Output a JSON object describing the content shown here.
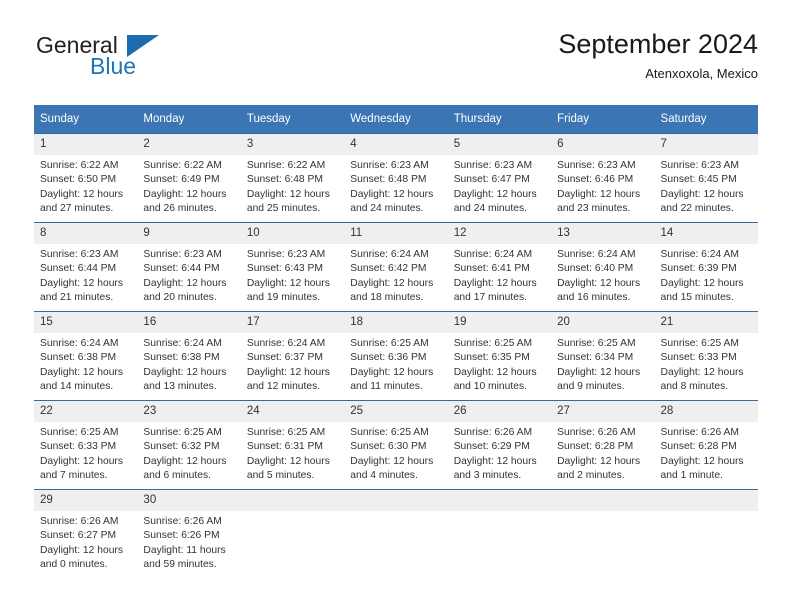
{
  "logo": {
    "text_primary": "General",
    "text_secondary": "Blue",
    "triangle_color": "#1b6cb0",
    "primary_color": "#231f20",
    "secondary_color": "#1b75bb"
  },
  "header": {
    "title": "September 2024",
    "subtitle": "Atenxoxola, Mexico"
  },
  "theme": {
    "header_row_bg": "#3b75b4",
    "header_row_text": "#ffffff",
    "daynum_bg": "#efefef",
    "cell_border": "#2e6da4"
  },
  "calendar": {
    "weekday_headers": [
      "Sunday",
      "Monday",
      "Tuesday",
      "Wednesday",
      "Thursday",
      "Friday",
      "Saturday"
    ],
    "weeks": [
      [
        {
          "day": "1",
          "sunrise": "Sunrise: 6:22 AM",
          "sunset": "Sunset: 6:50 PM",
          "daylight_line1": "Daylight: 12 hours",
          "daylight_line2": "and 27 minutes."
        },
        {
          "day": "2",
          "sunrise": "Sunrise: 6:22 AM",
          "sunset": "Sunset: 6:49 PM",
          "daylight_line1": "Daylight: 12 hours",
          "daylight_line2": "and 26 minutes."
        },
        {
          "day": "3",
          "sunrise": "Sunrise: 6:22 AM",
          "sunset": "Sunset: 6:48 PM",
          "daylight_line1": "Daylight: 12 hours",
          "daylight_line2": "and 25 minutes."
        },
        {
          "day": "4",
          "sunrise": "Sunrise: 6:23 AM",
          "sunset": "Sunset: 6:48 PM",
          "daylight_line1": "Daylight: 12 hours",
          "daylight_line2": "and 24 minutes."
        },
        {
          "day": "5",
          "sunrise": "Sunrise: 6:23 AM",
          "sunset": "Sunset: 6:47 PM",
          "daylight_line1": "Daylight: 12 hours",
          "daylight_line2": "and 24 minutes."
        },
        {
          "day": "6",
          "sunrise": "Sunrise: 6:23 AM",
          "sunset": "Sunset: 6:46 PM",
          "daylight_line1": "Daylight: 12 hours",
          "daylight_line2": "and 23 minutes."
        },
        {
          "day": "7",
          "sunrise": "Sunrise: 6:23 AM",
          "sunset": "Sunset: 6:45 PM",
          "daylight_line1": "Daylight: 12 hours",
          "daylight_line2": "and 22 minutes."
        }
      ],
      [
        {
          "day": "8",
          "sunrise": "Sunrise: 6:23 AM",
          "sunset": "Sunset: 6:44 PM",
          "daylight_line1": "Daylight: 12 hours",
          "daylight_line2": "and 21 minutes."
        },
        {
          "day": "9",
          "sunrise": "Sunrise: 6:23 AM",
          "sunset": "Sunset: 6:44 PM",
          "daylight_line1": "Daylight: 12 hours",
          "daylight_line2": "and 20 minutes."
        },
        {
          "day": "10",
          "sunrise": "Sunrise: 6:23 AM",
          "sunset": "Sunset: 6:43 PM",
          "daylight_line1": "Daylight: 12 hours",
          "daylight_line2": "and 19 minutes."
        },
        {
          "day": "11",
          "sunrise": "Sunrise: 6:24 AM",
          "sunset": "Sunset: 6:42 PM",
          "daylight_line1": "Daylight: 12 hours",
          "daylight_line2": "and 18 minutes."
        },
        {
          "day": "12",
          "sunrise": "Sunrise: 6:24 AM",
          "sunset": "Sunset: 6:41 PM",
          "daylight_line1": "Daylight: 12 hours",
          "daylight_line2": "and 17 minutes."
        },
        {
          "day": "13",
          "sunrise": "Sunrise: 6:24 AM",
          "sunset": "Sunset: 6:40 PM",
          "daylight_line1": "Daylight: 12 hours",
          "daylight_line2": "and 16 minutes."
        },
        {
          "day": "14",
          "sunrise": "Sunrise: 6:24 AM",
          "sunset": "Sunset: 6:39 PM",
          "daylight_line1": "Daylight: 12 hours",
          "daylight_line2": "and 15 minutes."
        }
      ],
      [
        {
          "day": "15",
          "sunrise": "Sunrise: 6:24 AM",
          "sunset": "Sunset: 6:38 PM",
          "daylight_line1": "Daylight: 12 hours",
          "daylight_line2": "and 14 minutes."
        },
        {
          "day": "16",
          "sunrise": "Sunrise: 6:24 AM",
          "sunset": "Sunset: 6:38 PM",
          "daylight_line1": "Daylight: 12 hours",
          "daylight_line2": "and 13 minutes."
        },
        {
          "day": "17",
          "sunrise": "Sunrise: 6:24 AM",
          "sunset": "Sunset: 6:37 PM",
          "daylight_line1": "Daylight: 12 hours",
          "daylight_line2": "and 12 minutes."
        },
        {
          "day": "18",
          "sunrise": "Sunrise: 6:25 AM",
          "sunset": "Sunset: 6:36 PM",
          "daylight_line1": "Daylight: 12 hours",
          "daylight_line2": "and 11 minutes."
        },
        {
          "day": "19",
          "sunrise": "Sunrise: 6:25 AM",
          "sunset": "Sunset: 6:35 PM",
          "daylight_line1": "Daylight: 12 hours",
          "daylight_line2": "and 10 minutes."
        },
        {
          "day": "20",
          "sunrise": "Sunrise: 6:25 AM",
          "sunset": "Sunset: 6:34 PM",
          "daylight_line1": "Daylight: 12 hours",
          "daylight_line2": "and 9 minutes."
        },
        {
          "day": "21",
          "sunrise": "Sunrise: 6:25 AM",
          "sunset": "Sunset: 6:33 PM",
          "daylight_line1": "Daylight: 12 hours",
          "daylight_line2": "and 8 minutes."
        }
      ],
      [
        {
          "day": "22",
          "sunrise": "Sunrise: 6:25 AM",
          "sunset": "Sunset: 6:33 PM",
          "daylight_line1": "Daylight: 12 hours",
          "daylight_line2": "and 7 minutes."
        },
        {
          "day": "23",
          "sunrise": "Sunrise: 6:25 AM",
          "sunset": "Sunset: 6:32 PM",
          "daylight_line1": "Daylight: 12 hours",
          "daylight_line2": "and 6 minutes."
        },
        {
          "day": "24",
          "sunrise": "Sunrise: 6:25 AM",
          "sunset": "Sunset: 6:31 PM",
          "daylight_line1": "Daylight: 12 hours",
          "daylight_line2": "and 5 minutes."
        },
        {
          "day": "25",
          "sunrise": "Sunrise: 6:25 AM",
          "sunset": "Sunset: 6:30 PM",
          "daylight_line1": "Daylight: 12 hours",
          "daylight_line2": "and 4 minutes."
        },
        {
          "day": "26",
          "sunrise": "Sunrise: 6:26 AM",
          "sunset": "Sunset: 6:29 PM",
          "daylight_line1": "Daylight: 12 hours",
          "daylight_line2": "and 3 minutes."
        },
        {
          "day": "27",
          "sunrise": "Sunrise: 6:26 AM",
          "sunset": "Sunset: 6:28 PM",
          "daylight_line1": "Daylight: 12 hours",
          "daylight_line2": "and 2 minutes."
        },
        {
          "day": "28",
          "sunrise": "Sunrise: 6:26 AM",
          "sunset": "Sunset: 6:28 PM",
          "daylight_line1": "Daylight: 12 hours",
          "daylight_line2": "and 1 minute."
        }
      ],
      [
        {
          "day": "29",
          "sunrise": "Sunrise: 6:26 AM",
          "sunset": "Sunset: 6:27 PM",
          "daylight_line1": "Daylight: 12 hours",
          "daylight_line2": "and 0 minutes."
        },
        {
          "day": "30",
          "sunrise": "Sunrise: 6:26 AM",
          "sunset": "Sunset: 6:26 PM",
          "daylight_line1": "Daylight: 11 hours",
          "daylight_line2": "and 59 minutes."
        },
        {
          "day": "",
          "sunrise": "",
          "sunset": "",
          "daylight_line1": "",
          "daylight_line2": ""
        },
        {
          "day": "",
          "sunrise": "",
          "sunset": "",
          "daylight_line1": "",
          "daylight_line2": ""
        },
        {
          "day": "",
          "sunrise": "",
          "sunset": "",
          "daylight_line1": "",
          "daylight_line2": ""
        },
        {
          "day": "",
          "sunrise": "",
          "sunset": "",
          "daylight_line1": "",
          "daylight_line2": ""
        },
        {
          "day": "",
          "sunrise": "",
          "sunset": "",
          "daylight_line1": "",
          "daylight_line2": ""
        }
      ]
    ]
  }
}
